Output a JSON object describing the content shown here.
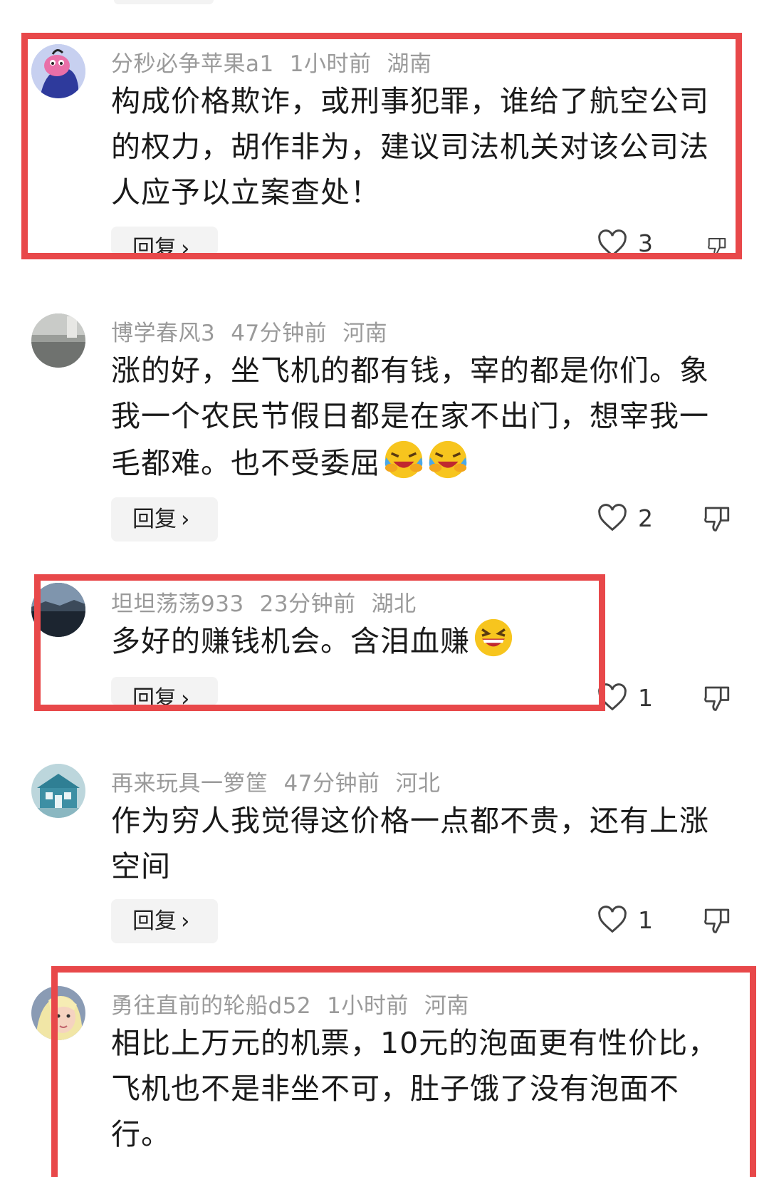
{
  "comments": [
    {
      "user": "分秒必争苹果a1",
      "time": "1小时前",
      "location": "湖南",
      "text": "构成价格欺诈，或刑事犯罪，谁给了航空公司的权力，胡作非为，建议司法机关对该公司法人应予以立案查处！",
      "reply_label": "回复",
      "likes": "3"
    },
    {
      "user": "博学春风3",
      "time": "47分钟前",
      "location": "河南",
      "text": "涨的好，坐飞机的都有钱，宰的都是你们。象我一个农民节假日都是在家不出门，想宰我一毛都难。也不受委屈",
      "emoji": [
        "laughing-crying-emoji",
        "laughing-crying-emoji"
      ],
      "reply_label": "回复",
      "likes": "2"
    },
    {
      "user": "坦坦荡荡933",
      "time": "23分钟前",
      "location": "湖北",
      "text": "多好的赚钱机会。含泪血赚",
      "emoji": [
        "grinning-squint-emoji"
      ],
      "reply_label": "回复",
      "likes": "1"
    },
    {
      "user": "再来玩具一箩筐",
      "time": "47分钟前",
      "location": "河北",
      "text": "作为穷人我觉得这价格一点都不贵，还有上涨空间",
      "reply_label": "回复",
      "likes": "1"
    },
    {
      "user": "勇往直前的轮船d52",
      "time": "1小时前",
      "location": "河南",
      "text": "相比上万元的机票，10元的泡面更有性价比，飞机也不是非坐不可，肚子饿了没有泡面不行。"
    }
  ],
  "colors": {
    "highlight_box": "#e8484a",
    "meta_text": "#9a9a9a",
    "reply_bg": "#f3f3f3"
  }
}
